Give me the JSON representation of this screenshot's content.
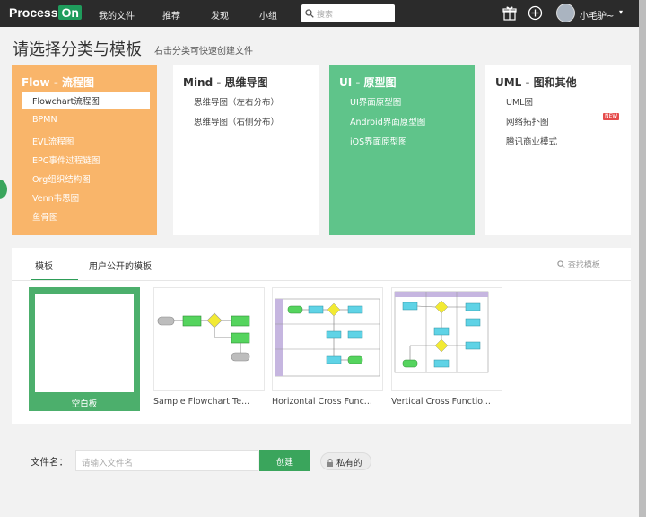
{
  "header": {
    "logo_left": "Process",
    "logo_right": "On",
    "nav": [
      "我的文件",
      "推荐",
      "发现",
      "小组"
    ],
    "search_placeholder": "搜索",
    "user_name": "小毛驴~",
    "caret": "▾",
    "gift_icon": "gift-icon",
    "plus_icon": "plus-circle-icon"
  },
  "page": {
    "title": "请选择分类与模板",
    "subtitle": "右击分类可快速创建文件"
  },
  "categories": [
    {
      "title": "Flow - 流程图",
      "items": [
        "Flowchart流程图",
        "BPMN",
        "EVL流程图",
        "EPC事件过程链图",
        "Org组织结构图",
        "Venn韦恩图",
        "鱼骨图"
      ]
    },
    {
      "title": "Mind - 思维导图",
      "items": [
        "思维导图（左右分布）",
        "思维导图（右侧分布）"
      ]
    },
    {
      "title": "UI - 原型图",
      "items": [
        "UI界面原型图",
        "Android界面原型图",
        "iOS界面原型图"
      ]
    },
    {
      "title": "UML - 图和其他",
      "items": [
        "UML图",
        "网络拓扑图",
        "腾讯商业模式"
      ],
      "badge": "NEW"
    }
  ],
  "templates": {
    "tabs": [
      "模板",
      "用户公开的模板"
    ],
    "search_label": "查找模板",
    "cards": [
      "空白板",
      "Sample Flowchart Te...",
      "Horizontal Cross Func...",
      "Vertical Cross Functio..."
    ]
  },
  "footer": {
    "filename_label": "文件名：",
    "filename_placeholder": "请输入文件名",
    "create_label": "创建",
    "private_label": "私有的"
  },
  "colors": {
    "topbar": "#2b2b2b",
    "flow": "#f9b56a",
    "ui": "#5fc48a",
    "accent": "#3aa55c"
  }
}
